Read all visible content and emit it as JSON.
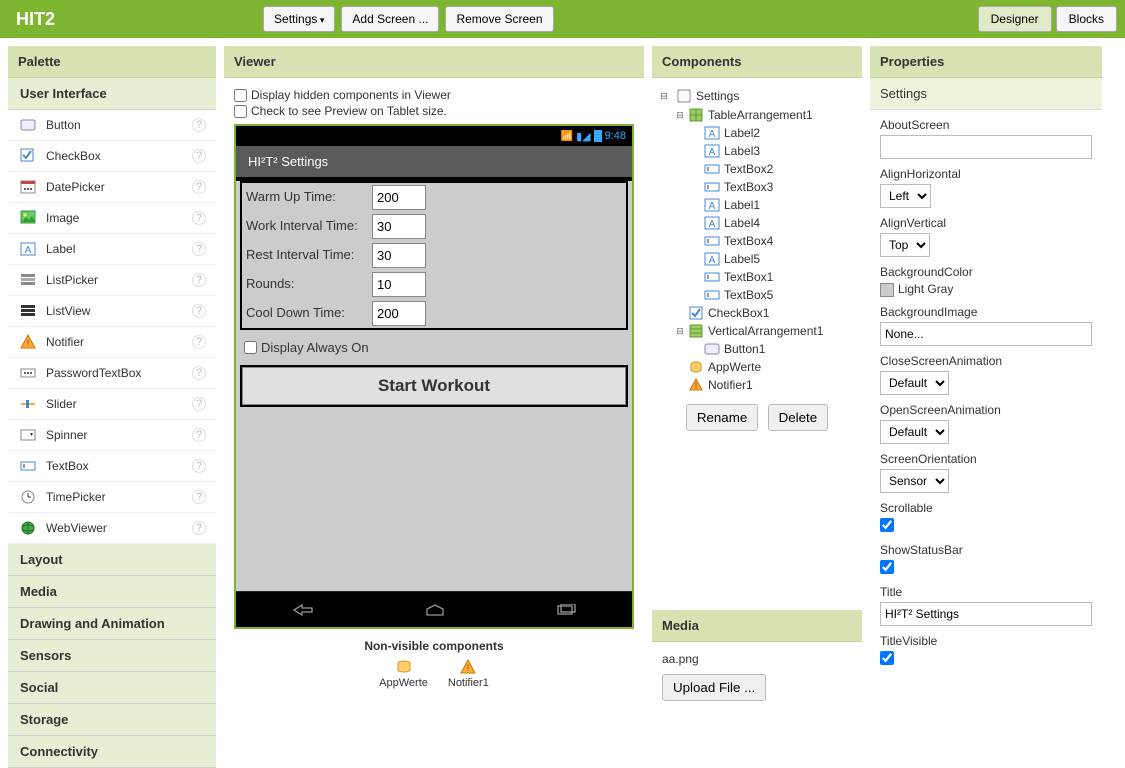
{
  "topbar": {
    "app_title": "HIT2",
    "settings_btn": "Settings",
    "add_screen_btn": "Add Screen ...",
    "remove_screen_btn": "Remove Screen",
    "designer_tab": "Designer",
    "blocks_tab": "Blocks"
  },
  "palette": {
    "header": "Palette",
    "sections": {
      "user_interface": {
        "title": "User Interface",
        "items": [
          {
            "icon": "button",
            "label": "Button"
          },
          {
            "icon": "checkbox",
            "label": "CheckBox"
          },
          {
            "icon": "datepicker",
            "label": "DatePicker"
          },
          {
            "icon": "image",
            "label": "Image"
          },
          {
            "icon": "label",
            "label": "Label"
          },
          {
            "icon": "listpicker",
            "label": "ListPicker"
          },
          {
            "icon": "listview",
            "label": "ListView"
          },
          {
            "icon": "notifier",
            "label": "Notifier"
          },
          {
            "icon": "password",
            "label": "PasswordTextBox"
          },
          {
            "icon": "slider",
            "label": "Slider"
          },
          {
            "icon": "spinner",
            "label": "Spinner"
          },
          {
            "icon": "textbox",
            "label": "TextBox"
          },
          {
            "icon": "timepicker",
            "label": "TimePicker"
          },
          {
            "icon": "webviewer",
            "label": "WebViewer"
          }
        ]
      },
      "layout": "Layout",
      "media": "Media",
      "drawing": "Drawing and Animation",
      "sensors": "Sensors",
      "social": "Social",
      "storage": "Storage",
      "connectivity": "Connectivity"
    }
  },
  "viewer": {
    "header": "Viewer",
    "hidden_label": "Display hidden components in Viewer",
    "tablet_label": "Check to see Preview on Tablet size.",
    "phone": {
      "clock": "9:48",
      "title": "HI²T² Settings",
      "rows": [
        {
          "label": "Warm Up Time:",
          "value": "200"
        },
        {
          "label": "Work Interval Time:",
          "value": "30"
        },
        {
          "label": "Rest Interval Time:",
          "value": "30"
        },
        {
          "label": "Rounds:",
          "value": "10"
        },
        {
          "label": "Cool Down Time:",
          "value": "200"
        }
      ],
      "display_always": "Display Always On",
      "start_btn": "Start Workout"
    },
    "nonvis_header": "Non-visible components",
    "nonvis_items": [
      {
        "name": "AppWerte",
        "icon": "db"
      },
      {
        "name": "Notifier1",
        "icon": "warn"
      }
    ]
  },
  "components": {
    "header": "Components",
    "tree": {
      "root": "Settings",
      "table": "TableArrangement1",
      "table_children": [
        "Label2",
        "Label3",
        "TextBox2",
        "TextBox3",
        "Label1",
        "Label4",
        "TextBox4",
        "Label5",
        "TextBox1",
        "TextBox5"
      ],
      "checkbox": "CheckBox1",
      "vert": "VerticalArrangement1",
      "vert_children": [
        "Button1"
      ],
      "appwerte": "AppWerte",
      "notifier": "Notifier1"
    },
    "rename_btn": "Rename",
    "delete_btn": "Delete"
  },
  "media_panel": {
    "header": "Media",
    "file": "aa.png",
    "upload_btn": "Upload File ..."
  },
  "properties": {
    "header": "Properties",
    "subheader": "Settings",
    "rows": {
      "about_screen_label": "AboutScreen",
      "about_screen_value": "",
      "align_h_label": "AlignHorizontal",
      "align_h_value": "Left",
      "align_v_label": "AlignVertical",
      "align_v_value": "Top",
      "bg_color_label": "BackgroundColor",
      "bg_color_value": "Light Gray",
      "bg_image_label": "BackgroundImage",
      "bg_image_value": "None...",
      "close_anim_label": "CloseScreenAnimation",
      "close_anim_value": "Default",
      "open_anim_label": "OpenScreenAnimation",
      "open_anim_value": "Default",
      "orient_label": "ScreenOrientation",
      "orient_value": "Sensor",
      "scrollable_label": "Scrollable",
      "showstatus_label": "ShowStatusBar",
      "title_label": "Title",
      "title_value": "HI²T² Settings",
      "titlevisible_label": "TitleVisible"
    }
  }
}
